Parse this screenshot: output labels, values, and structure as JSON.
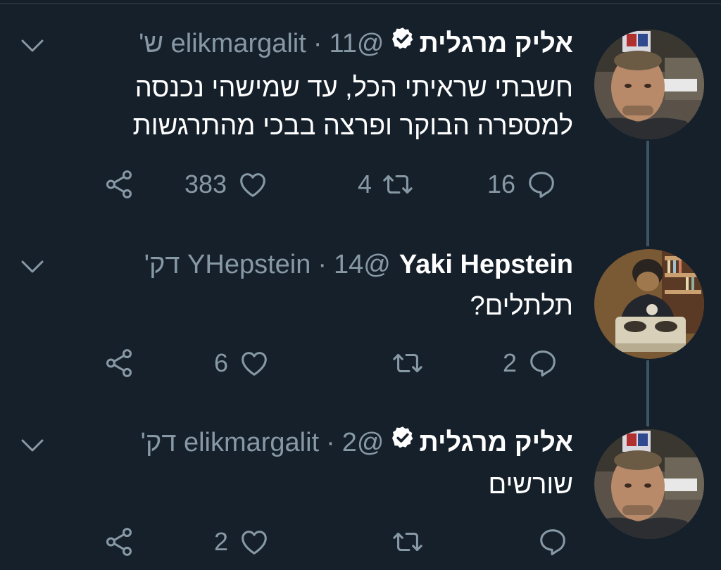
{
  "theme": {
    "background": "#15202b",
    "muted": "#8899a6",
    "thread_line": "#3d5466",
    "verified_fill": "#ffffff"
  },
  "tweets": [
    {
      "display_name": "אליק מרגלית",
      "verified": true,
      "handle": "@elikmargalit",
      "separator": "·",
      "time": "11 ש'",
      "text_lines": [
        "חשבתי שראיתי הכל, עד שמישהי נכנסה",
        "למספרה הבוקר ופרצה בבכי מהתרגשות"
      ],
      "replies": "16",
      "retweets": "4",
      "likes": "383",
      "avatar_icon": "man-portrait-avatar"
    },
    {
      "display_name": "Yaki Hepstein",
      "verified": false,
      "handle": "@YHepstein",
      "separator": "·",
      "time": "14 דק'",
      "text_lines": [
        "תלתלים?"
      ],
      "replies": "2",
      "retweets": "",
      "likes": "6",
      "avatar_icon": "man-with-record-player-avatar"
    },
    {
      "display_name": "אליק מרגלית",
      "verified": true,
      "handle": "@elikmargalit",
      "separator": "·",
      "time": "2 דק'",
      "text_lines": [
        "שורשים"
      ],
      "replies": "",
      "retweets": "",
      "likes": "2",
      "avatar_icon": "man-portrait-avatar"
    }
  ]
}
